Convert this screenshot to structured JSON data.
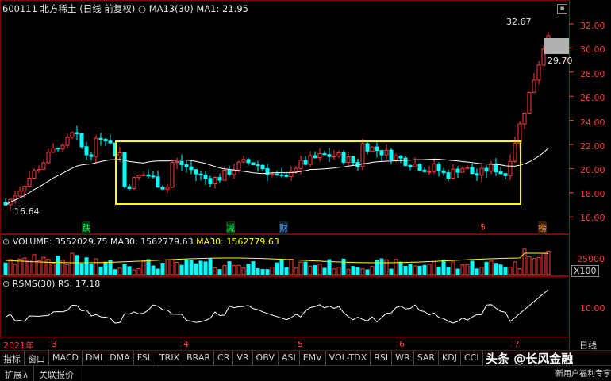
{
  "header": {
    "symbol": "600111 北方稀土 (日线 前复权)",
    "circle_icon": "○",
    "ma13_label": "MA13(30)",
    "ma1_label": "MA1: 21.95"
  },
  "price_axis": {
    "ticks": [
      "32.00",
      "30.00",
      "28.00",
      "26.00",
      "24.00",
      "22.00",
      "20.00",
      "18.00",
      "16.00"
    ],
    "high_marker": "32.67",
    "low_marker": "16.64",
    "current_price": "29.70"
  },
  "event_markers": [
    "跌",
    "减",
    "财",
    "$",
    "榜"
  ],
  "volume": {
    "title": "VOLUME: 3552029.75",
    "ma30_a": "MA30: 1562779.63",
    "ma30_b": "MA30: 1562779.63",
    "tick": "25000",
    "unit": "X100"
  },
  "rsms": {
    "title": "RSMS(30)",
    "rs": "RS: 17.18",
    "tick": "10.00"
  },
  "date_axis": {
    "year": "2021年",
    "months": [
      "3",
      "4",
      "5",
      "6",
      "7"
    ],
    "period": "日线"
  },
  "indicator_tabs": [
    "指标",
    "窗口",
    "MACD",
    "DMI",
    "DMA",
    "FSL",
    "TRIX",
    "BRAR",
    "CR",
    "VR",
    "OBV",
    "ASI",
    "EMV",
    "VOL-TDX",
    "RSI",
    "WR",
    "SAR",
    "KDJ",
    "CCI"
  ],
  "bottom_tabs": [
    "扩展∧",
    "关联报价"
  ],
  "watermark": {
    "brand": "头条 @长风金融",
    "promo": "新用户福利专享"
  },
  "colors": {
    "up": "#ff3b3b",
    "down": "#00ffff",
    "frame": "#ffff00",
    "ma": "#ffffff"
  }
}
